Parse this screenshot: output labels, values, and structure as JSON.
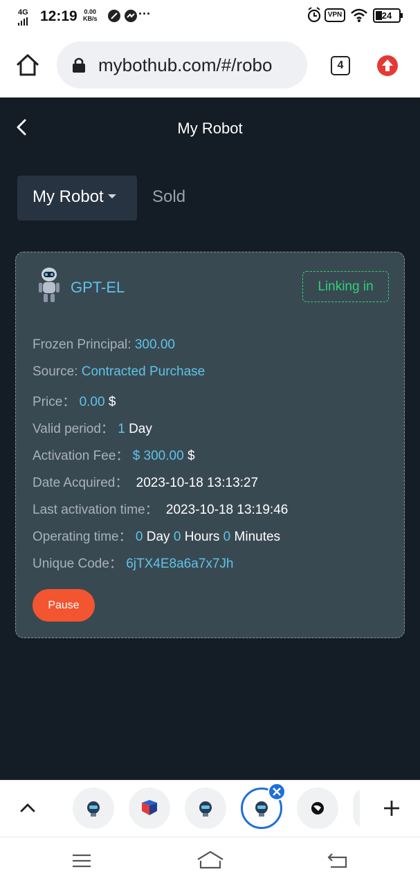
{
  "statusbar": {
    "network": "4G",
    "time": "12:19",
    "speed_value": "0.00",
    "speed_unit": "KB/s",
    "more": "···",
    "vpn": "VPN",
    "battery": "24"
  },
  "browser": {
    "url": "mybothub.com/#/robo",
    "tab_count": "4"
  },
  "page": {
    "title": "My Robot"
  },
  "tabs": {
    "my_robot": "My Robot",
    "sold": "Sold"
  },
  "robot": {
    "name": "GPT-EL",
    "status": "Linking in",
    "frozen_principal_label": "Frozen Principal:",
    "frozen_principal_value": "300.00",
    "source_label": "Source:",
    "source_value": "Contracted Purchase",
    "price_label": "Price：",
    "price_value": "0.00",
    "price_unit": "$",
    "valid_period_label": "Valid period：",
    "valid_period_value": "1",
    "valid_period_unit": "Day",
    "activation_fee_label": "Activation Fee：",
    "activation_fee_value": "$ 300.00",
    "activation_fee_unit": "$",
    "date_acquired_label": "Date Acquired：",
    "date_acquired_value": "2023-10-18 13:13:27",
    "last_activation_label": "Last activation time：",
    "last_activation_value": "2023-10-18 13:19:46",
    "operating_time_label": "Operating time：",
    "operating_days": "0",
    "operating_days_unit": "Day",
    "operating_hours": "0",
    "operating_hours_unit": "Hours",
    "operating_minutes": "0",
    "operating_minutes_unit": "Minutes",
    "unique_code_label": "Unique Code：",
    "unique_code_value": "6jTX4E8a6a7x7Jh",
    "pause_label": "Pause"
  },
  "colors": {
    "background": "#141d26",
    "card": "#394952",
    "accent_blue": "#5fc3e8",
    "accent_green": "#2fd07a",
    "pause_button": "#f25530",
    "tab_active": "#283341"
  },
  "icons": {
    "home": "home-icon",
    "lock": "lock-icon",
    "upload": "red-upload-icon",
    "back": "chevron-left-icon",
    "robot": "robot-avatar-icon",
    "collapse": "chevron-up-icon",
    "add_tab": "plus-icon",
    "close_tab": "close-icon",
    "menu": "menu-icon",
    "nav_home": "home-outline-icon",
    "nav_back": "back-arrow-icon"
  }
}
